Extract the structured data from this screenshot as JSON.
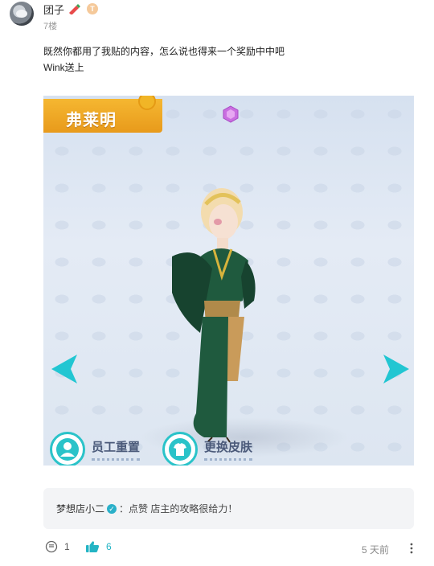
{
  "user": {
    "name": "团子",
    "floor": "7楼",
    "level_badge": "T"
  },
  "post": {
    "lines": [
      "既然你都用了我贴的内容，怎么说也得来一个奖励中中吧",
      "Wink送上"
    ]
  },
  "game_screenshot": {
    "character_name": "弗莱明",
    "buttons": [
      "员工重置",
      "更换皮肤"
    ],
    "icons": [
      "pin-icon",
      "gem-icon",
      "arrow-left-icon",
      "arrow-right-icon",
      "staff-reset-icon",
      "tshirt-icon"
    ]
  },
  "comment": {
    "author": "梦想店小二",
    "text": "：点赞 店主的攻略很给力！"
  },
  "footer": {
    "comment_count": "1",
    "like_count": "6",
    "time": "5 天前"
  },
  "colors": {
    "accent": "#23b4c4",
    "banner": "#f0a826",
    "muted": "#9a9a9a"
  }
}
